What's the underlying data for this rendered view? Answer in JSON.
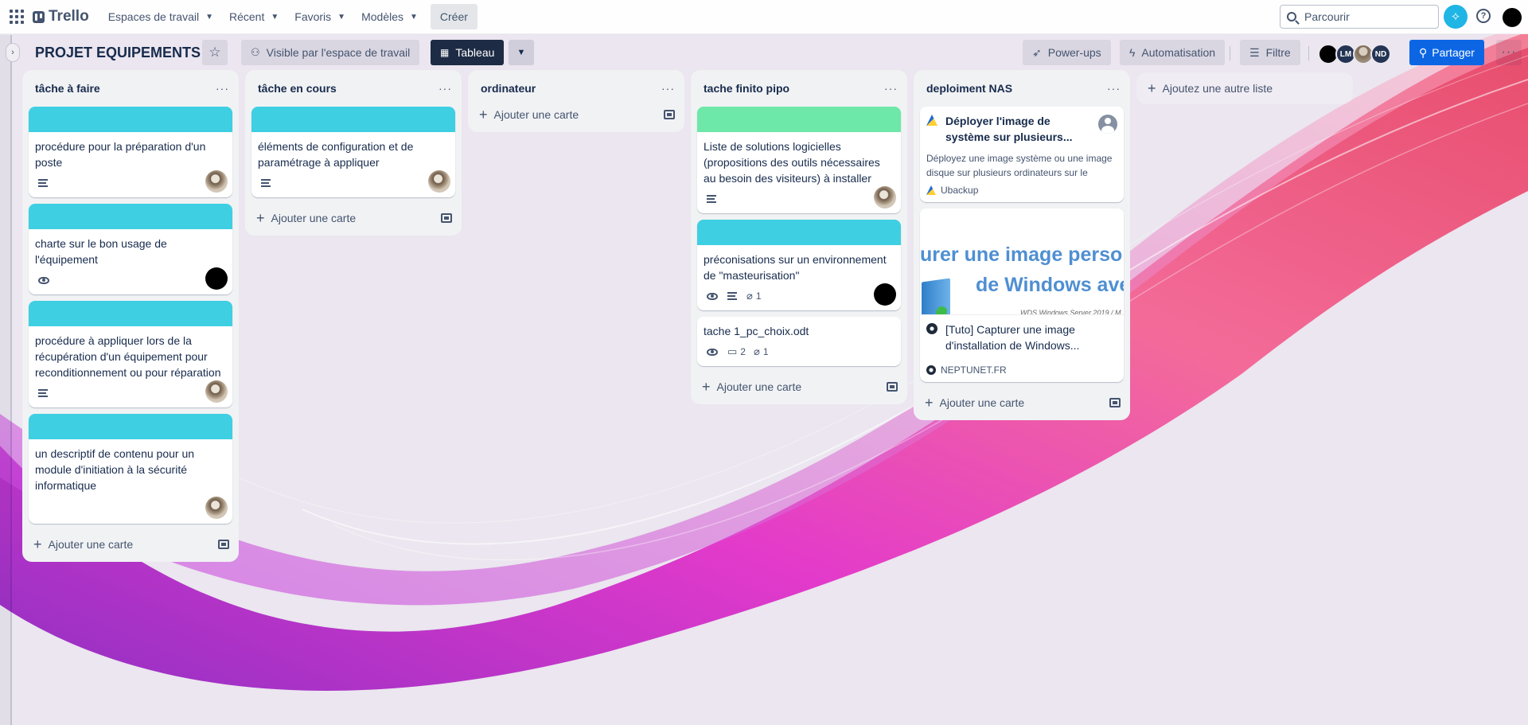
{
  "topbar": {
    "logo": "Trello",
    "nav": [
      {
        "label": "Espaces de travail"
      },
      {
        "label": "Récent"
      },
      {
        "label": "Favoris"
      },
      {
        "label": "Modèles"
      }
    ],
    "create": "Créer",
    "search_placeholder": "Parcourir"
  },
  "board": {
    "title": "PROJET EQUIPEMENTS",
    "visibility": "Visible par l'espace de travail",
    "view": "Tableau",
    "powerups": "Power-ups",
    "automation": "Automatisation",
    "filter": "Filtre",
    "members": [
      {
        "initials": "",
        "style": "black"
      },
      {
        "initials": "LM",
        "style": "navy"
      },
      {
        "initials": "",
        "style": "photo"
      },
      {
        "initials": "ND",
        "style": "navy"
      }
    ],
    "share": "Partager",
    "add_list": "Ajoutez une autre liste"
  },
  "lists": [
    {
      "title": "tâche à faire",
      "add_card": "Ajouter une carte",
      "cards": [
        {
          "title": "procédure pour la préparation d'un poste"
        },
        {
          "title": "charte sur le bon usage de l'équipement"
        },
        {
          "title": "procédure à appliquer lors de la récupération d'un équipement pour reconditionnement ou pour réparation"
        },
        {
          "title": "un descriptif de contenu pour un module d'initiation à la sécurité informatique"
        }
      ]
    },
    {
      "title": "tâche en cours",
      "add_card": "Ajouter une carte",
      "cards": [
        {
          "title": "éléments de configuration et de paramétrage à appliquer"
        }
      ]
    },
    {
      "title": "ordinateur",
      "add_card": "Ajouter une carte",
      "cards": []
    },
    {
      "title": "tache finito pipo",
      "add_card": "Ajouter une carte",
      "cards": [
        {
          "title": "Liste de solutions logicielles (propositions des outils nécessaires au besoin des visiteurs) à installer"
        },
        {
          "title": "préconisations sur un environnement de \"masteurisation\"",
          "attachments": "1"
        },
        {
          "title": "tache 1_pc_choix.odt",
          "comments": "2",
          "attachments": "1"
        }
      ]
    },
    {
      "title": "deploiment NAS",
      "add_card": "Ajouter une carte",
      "cards": [
        {
          "title": "Déployer l'image de système sur plusieurs...",
          "description": "Déployez une image système ou une image disque sur plusieurs ordinateurs sur le mêm...",
          "source": "Ubackup"
        },
        {
          "preview_line1": "urer une image person",
          "preview_line2": "de Windows ave",
          "preview_small": "WDS Windows Server 2019 / M",
          "title": "[Tuto] Capturer une image d'installation de Windows...",
          "source": "NEPTUNET.FR"
        }
      ]
    }
  ],
  "colors": {
    "cover_cyan": "#3ecfe2",
    "cover_green": "#6de8a8",
    "share_blue": "#0c66e4",
    "view_dark": "#1d2b45"
  }
}
